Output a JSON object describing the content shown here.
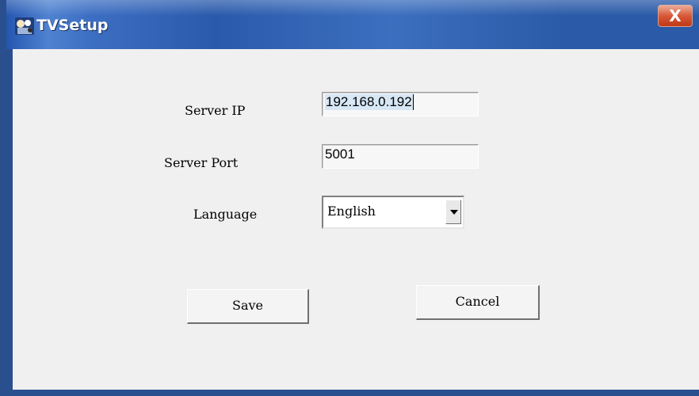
{
  "window": {
    "title": "TVSetup",
    "close_label": "X",
    "colors": {
      "titlebar": "#2a5aab",
      "close": "#d85838",
      "client": "#f0f0f0"
    }
  },
  "form": {
    "server_ip": {
      "label": "Server IP",
      "value": "192.168.0.192"
    },
    "server_port": {
      "label": "Server Port",
      "value": "5001"
    },
    "language": {
      "label": "Language",
      "selected": "English"
    }
  },
  "buttons": {
    "save": "Save",
    "cancel": "Cancel"
  },
  "icons": {
    "app": "tv-setup-app-icon",
    "close": "close-icon",
    "dropdown": "chevron-down-icon"
  }
}
